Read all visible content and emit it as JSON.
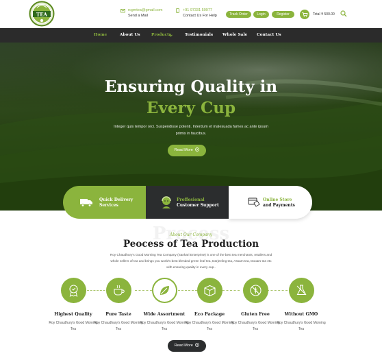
{
  "header": {
    "logo_text": "TEA",
    "email": "rcgmtea@gmail.com",
    "email_label": "Send a Mail",
    "phone": "+91 97331 59977",
    "phone_label": "Contact Us For Help",
    "track_order": "Track Order",
    "login": "Login",
    "register": "Register",
    "cart_total": "Total ₹ 500.00"
  },
  "nav": {
    "items": [
      "Home",
      "About Us",
      "Products",
      "Testimonials",
      "Whole Sale",
      "Contact Us"
    ],
    "active": "Home"
  },
  "hero": {
    "title_line1": "Ensuring Quality in",
    "title_line2": "Every Cup",
    "paragraph": "Integer quis tempor orci. Suspendisse potenti. Interdum et malesuada fames ac ante ipsum primis in faucibus.",
    "button": "Read More"
  },
  "features_strip": [
    {
      "line1": "Quick Delivery",
      "line2": "Services",
      "icon": "truck-icon"
    },
    {
      "line1": "Proffesional",
      "line2": "Customer Support",
      "icon": "support-agent-icon"
    },
    {
      "line1": "Online Store",
      "line2": "and Payments",
      "icon": "payment-icon"
    }
  ],
  "about": {
    "watermark": "Process",
    "subtitle": "About Our Company",
    "heading": "Peocess of Tea Production",
    "paragraph": "Roy Chaudhury's Good Morning Tea Company (Sankari Enterprise) is one of the best tea merchants, retailers and whole sellers of tea and brings you world's best blended green leaf tea, Darjeeling tea, Assam tea, Dooars tea etc with ensuring quality in every cup..",
    "button": "Read More"
  },
  "features": [
    {
      "title": "Highest Quality",
      "desc": "Roy Chaudhury's Good Morning Tea",
      "icon": "quality-badge-icon"
    },
    {
      "title": "Pure Taste",
      "desc": "Roy Chaudhury's Good Morning Tea",
      "icon": "tea-cup-icon"
    },
    {
      "title": "Wide Assortment",
      "desc": "Roy Chaudhury's Good Morning Tea",
      "icon": "leaf-icon"
    },
    {
      "title": "Eco Package",
      "desc": "Roy Chaudhury's Good Morning Tea",
      "icon": "eco-package-icon"
    },
    {
      "title": "Gluten Free",
      "desc": "Roy Chaudhury's Good Morning Tea",
      "icon": "gluten-free-icon"
    },
    {
      "title": "Without GMO",
      "desc": "Roy Chaudhury's Good Morning Tea",
      "icon": "no-gmo-icon"
    }
  ],
  "colors": {
    "accent": "#8bb43d",
    "dark": "#2b2d2e"
  }
}
